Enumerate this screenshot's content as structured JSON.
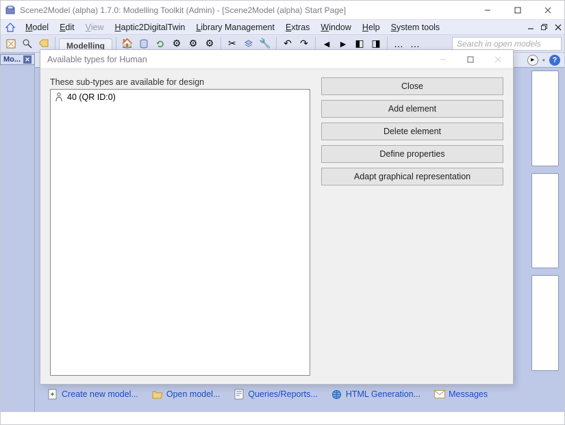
{
  "window": {
    "title": "Scene2Model (alpha) 1.7.0: Modelling Toolkit (Admin) - [Scene2Model (alpha) Start Page]"
  },
  "menu": {
    "items": [
      {
        "label": "Model",
        "accel_index": 0
      },
      {
        "label": "Edit",
        "accel_index": 0
      },
      {
        "label": "View",
        "accel_index": 0,
        "disabled": true
      },
      {
        "label": "Haptic2DigitalTwin",
        "accel_index": 0
      },
      {
        "label": "Library Management",
        "accel_index": 0
      },
      {
        "label": "Extras",
        "accel_index": 0
      },
      {
        "label": "Window",
        "accel_index": 0
      },
      {
        "label": "Help",
        "accel_index": 0
      },
      {
        "label": "System tools",
        "accel_index": 0
      }
    ]
  },
  "toolbar": {
    "modelling_tab": "Modelling",
    "search_placeholder": "Search in open models"
  },
  "sidebar": {
    "tab_label": "Mo..."
  },
  "bottom_links": [
    {
      "name": "create-new-model",
      "label": "Create new model...",
      "icon": "file-plus-icon"
    },
    {
      "name": "open-model",
      "label": "Open model...",
      "icon": "folder-open-icon"
    },
    {
      "name": "queries-reports",
      "label": "Queries/Reports...",
      "icon": "report-icon"
    },
    {
      "name": "html-generation",
      "label": "HTML Generation...",
      "icon": "globe-icon"
    },
    {
      "name": "messages",
      "label": "Messages",
      "icon": "mail-icon"
    }
  ],
  "dialog": {
    "title": "Available types for Human",
    "label": "These sub-types are available for design",
    "items": [
      {
        "label": "40 (QR ID:0)"
      }
    ],
    "buttons": {
      "close": "Close",
      "add": "Add element",
      "delete": "Delete element",
      "define": "Define properties",
      "adapt": "Adapt graphical representation"
    }
  }
}
